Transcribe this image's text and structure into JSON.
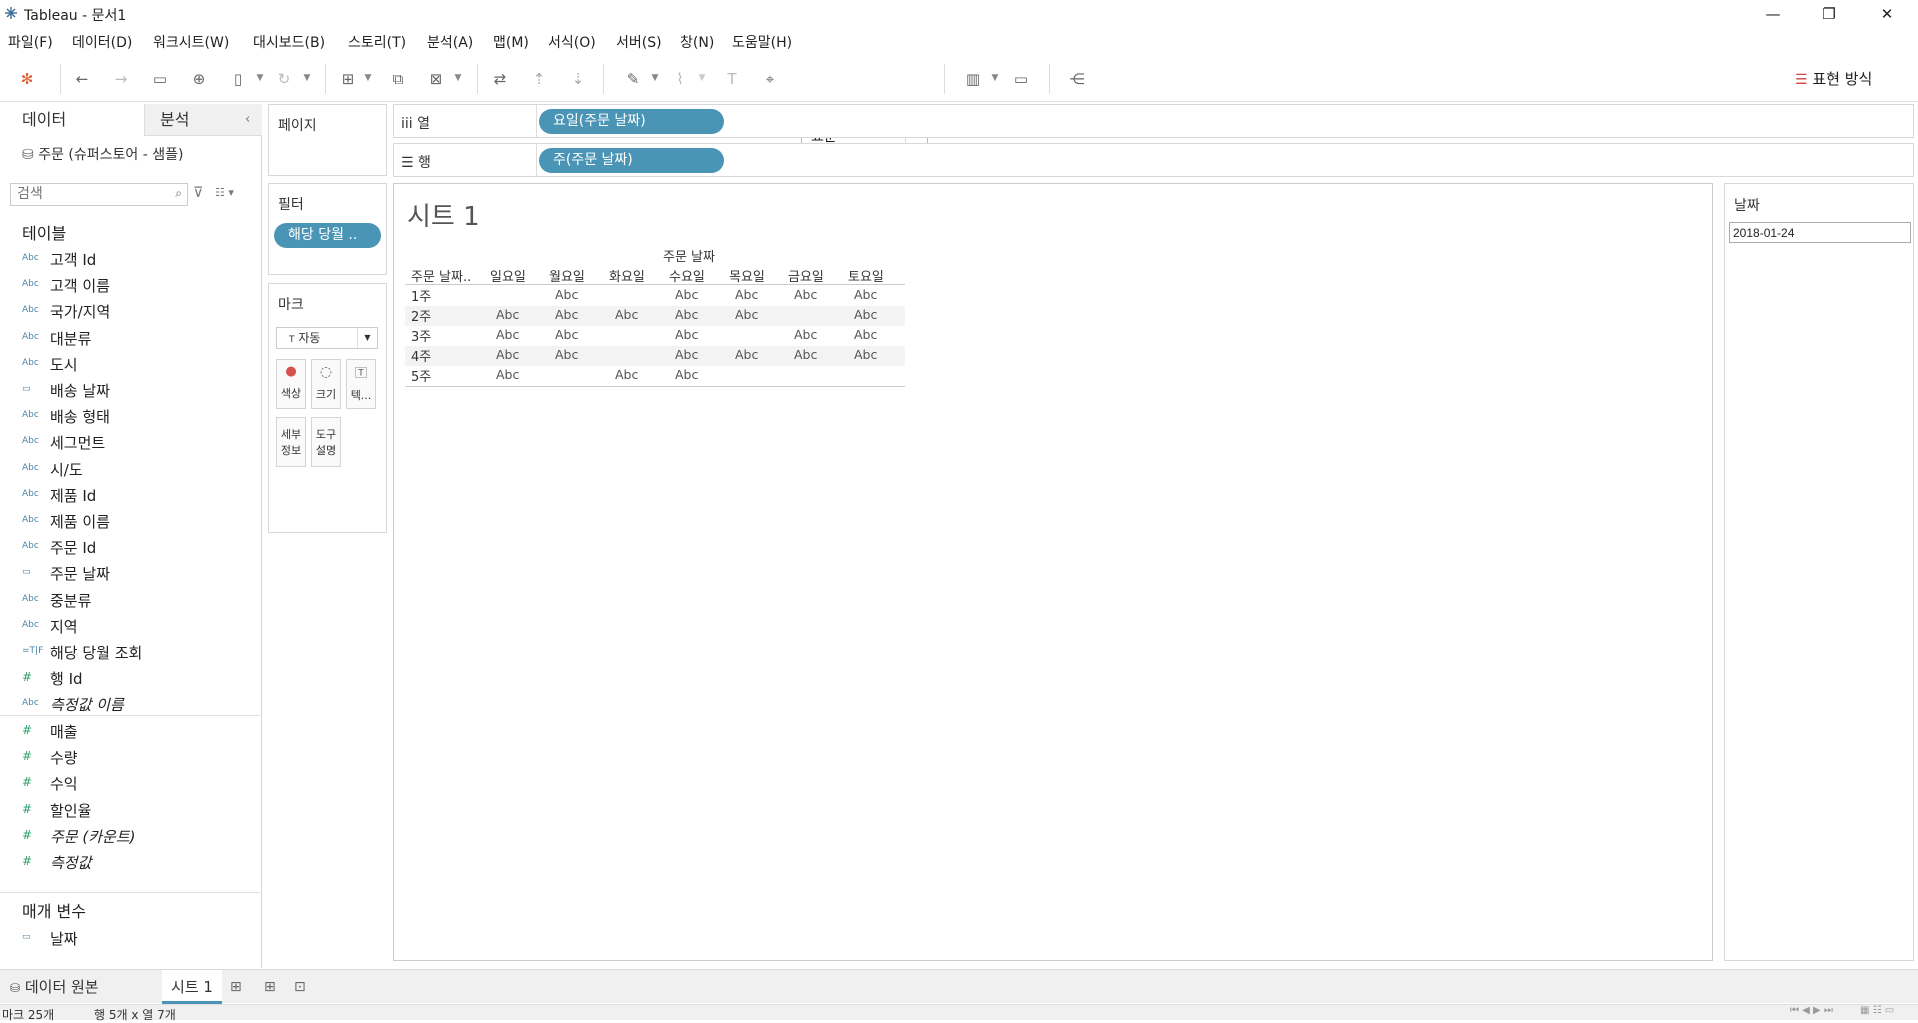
{
  "window": {
    "title": "Tableau - 문서1"
  },
  "menu": [
    "파일(F)",
    "데이터(D)",
    "워크시트(W)",
    "대시보드(B)",
    "스토리(T)",
    "분석(A)",
    "맵(M)",
    "서식(O)",
    "서버(S)",
    "창(N)",
    "도움말(H)"
  ],
  "toolbar": {
    "fit_value": "표준",
    "show_me": "표현 방식"
  },
  "data_pane": {
    "tab_data": "데이터",
    "tab_analysis": "분석",
    "datasource": "주문 (슈퍼스토어 - 샘플)",
    "search_placeholder": "검색",
    "tables_title": "테이블",
    "dimensions": [
      {
        "icon": "Abc",
        "label": "고객 Id"
      },
      {
        "icon": "Abc",
        "label": "고객 이름"
      },
      {
        "icon": "Abc",
        "label": "국가/지역"
      },
      {
        "icon": "Abc",
        "label": "대분류"
      },
      {
        "icon": "Abc",
        "label": "도시"
      },
      {
        "icon": "date",
        "label": "배송 날짜"
      },
      {
        "icon": "Abc",
        "label": "배송 형태"
      },
      {
        "icon": "Abc",
        "label": "세그먼트"
      },
      {
        "icon": "Abc",
        "label": "시/도"
      },
      {
        "icon": "Abc",
        "label": "제품 Id"
      },
      {
        "icon": "Abc",
        "label": "제품 이름"
      },
      {
        "icon": "Abc",
        "label": "주문 Id"
      },
      {
        "icon": "date",
        "label": "주문 날짜"
      },
      {
        "icon": "Abc",
        "label": "중분류"
      },
      {
        "icon": "Abc",
        "label": "지역"
      },
      {
        "icon": "TF",
        "label": "해당 당월 조회"
      },
      {
        "icon": "#",
        "label": "행 Id"
      },
      {
        "icon": "Abc",
        "label": "측정값 이름",
        "italic": true
      }
    ],
    "measures": [
      {
        "icon": "#",
        "label": "매출"
      },
      {
        "icon": "#",
        "label": "수량"
      },
      {
        "icon": "#",
        "label": "수익"
      },
      {
        "icon": "#",
        "label": "할인율"
      },
      {
        "icon": "#",
        "label": "주문 (카운트)",
        "italic": true
      },
      {
        "icon": "#",
        "label": "측정값",
        "italic": true
      }
    ],
    "params_title": "매개 변수",
    "params": [
      {
        "icon": "date",
        "label": "날짜"
      }
    ]
  },
  "shelves": {
    "pages_title": "페이지",
    "columns_label": "열",
    "columns_pill": "요일(주문 날짜)",
    "rows_label": "행",
    "rows_pill": "주(주문 날짜)",
    "filters_title": "필터",
    "filter_pill": "해당 당월 ..",
    "marks_title": "마크",
    "mark_type": "자동",
    "mark_buttons": [
      "색상",
      "크기",
      "텍..."
    ],
    "mark_buttons2": [
      "세부\n정보",
      "도구\n설명"
    ]
  },
  "view": {
    "sheet_title": "시트 1",
    "col_header_title": "주문 날짜",
    "row_header": "주문 날짜..",
    "days": [
      "일요일",
      "월요일",
      "화요일",
      "수요일",
      "목요일",
      "금요일",
      "토요일"
    ],
    "rows": [
      {
        "label": "1주",
        "cells": [
          "",
          "Abc",
          "",
          "Abc",
          "Abc",
          "Abc",
          "Abc"
        ]
      },
      {
        "label": "2주",
        "cells": [
          "Abc",
          "Abc",
          "Abc",
          "Abc",
          "Abc",
          "",
          "Abc"
        ]
      },
      {
        "label": "3주",
        "cells": [
          "Abc",
          "Abc",
          "",
          "Abc",
          "",
          "Abc",
          "Abc"
        ]
      },
      {
        "label": "4주",
        "cells": [
          "Abc",
          "Abc",
          "",
          "Abc",
          "Abc",
          "Abc",
          "Abc"
        ]
      },
      {
        "label": "5주",
        "cells": [
          "Abc",
          "",
          "Abc",
          "Abc",
          "",
          "",
          ""
        ]
      }
    ]
  },
  "param_card": {
    "title": "날짜",
    "value": "2018-01-24"
  },
  "bottom_tabs": {
    "datasource": "데이터 원본",
    "sheet": "시트 1"
  },
  "status": {
    "marks": "마크 25개",
    "rows_cols": "행 5개 x 열 7개"
  }
}
